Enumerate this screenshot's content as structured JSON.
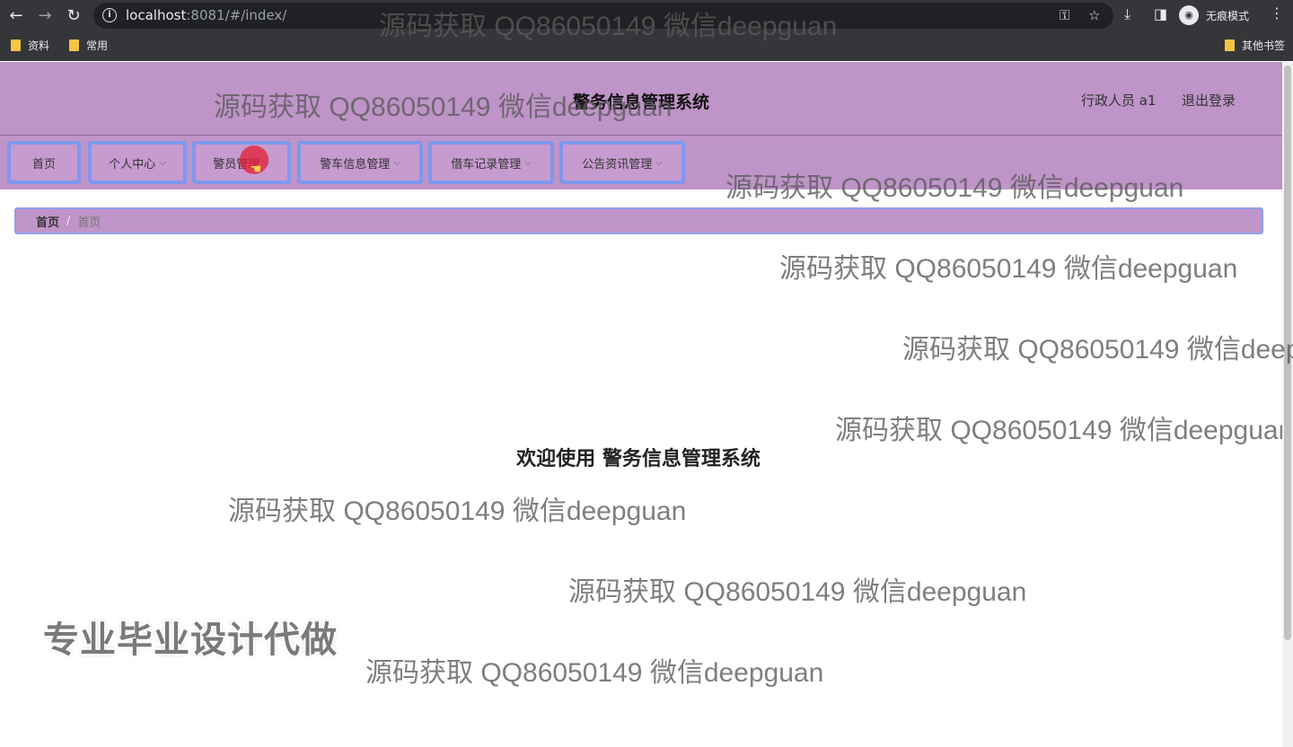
{
  "browser": {
    "url_host": "localhost",
    "url_rest": ":8081/#/index/",
    "incognito_label": "无痕模式",
    "bookmarks": [
      {
        "label": "资料"
      },
      {
        "label": "常用"
      }
    ],
    "other_bookmarks": "其他书签"
  },
  "header": {
    "title": "警务信息管理系统",
    "user": "行政人员 a1",
    "logout": "退出登录"
  },
  "nav": {
    "items": [
      {
        "label": "首页"
      },
      {
        "label": "个人中心"
      },
      {
        "label": "警员管理"
      },
      {
        "label": "警车信息管理"
      },
      {
        "label": "借车记录管理"
      },
      {
        "label": "公告资讯管理"
      }
    ],
    "chevron": "⌵"
  },
  "breadcrumb": {
    "home": "首页",
    "separator": "/",
    "current": "首页"
  },
  "main": {
    "welcome": "欢迎使用 警务信息管理系统"
  },
  "overlay": {
    "watermark": "源码获取 QQ86050149 微信deepguan",
    "promo": "专业毕业设计代做"
  },
  "colors": {
    "header_bg": "#bf94c8",
    "nav_border": "#7e98ef"
  }
}
